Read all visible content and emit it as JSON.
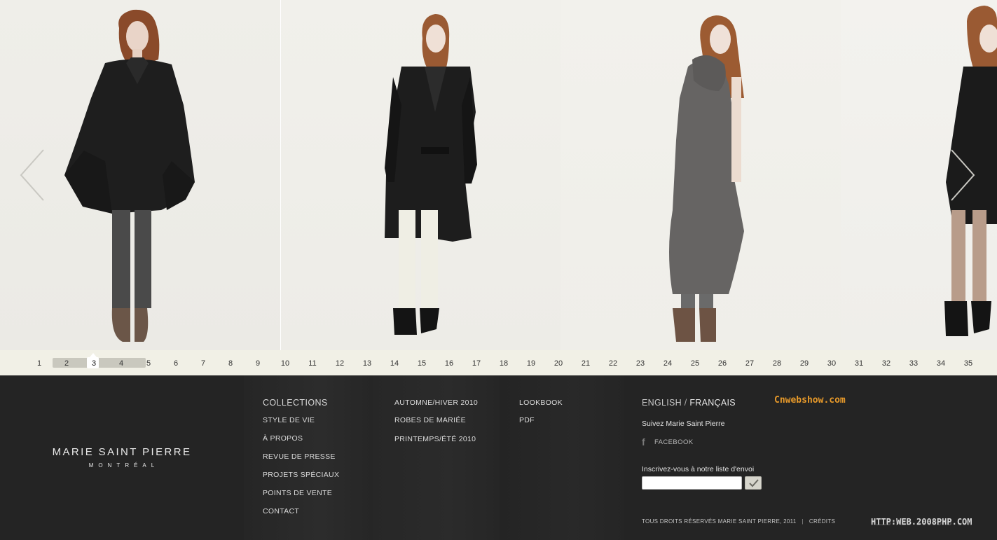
{
  "pager": {
    "current_page": 3,
    "pages": [
      "1",
      "2",
      "3",
      "4",
      "5",
      "6",
      "7",
      "8",
      "9",
      "10",
      "11",
      "12",
      "13",
      "14",
      "15",
      "16",
      "17",
      "18",
      "19",
      "20",
      "21",
      "22",
      "23",
      "24",
      "25",
      "26",
      "27",
      "28",
      "29",
      "30",
      "31",
      "32",
      "33",
      "34",
      "35"
    ]
  },
  "brand": {
    "name": "MARIE SAINT PIERRE",
    "city": "MONTRÉAL"
  },
  "nav": {
    "col1": {
      "heading": "COLLECTIONS",
      "items": [
        "STYLE DE VIE",
        "À PROPOS",
        "REVUE DE PRESSE",
        "PROJETS SPÉCIAUX",
        "POINTS DE VENTE",
        "CONTACT"
      ]
    },
    "col2": {
      "items": [
        "AUTOMNE/HIVER 2010",
        "ROBES DE MARIÉE",
        "PRINTEMPS/ÉTÉ 2010"
      ]
    },
    "col3": {
      "items": [
        "LOOKBOOK",
        "PDF"
      ]
    }
  },
  "lang": {
    "english": "ENGLISH",
    "separator": "/",
    "french": "FRANÇAIS"
  },
  "social": {
    "follow": "Suivez Marie Saint Pierre",
    "facebook": "FACEBOOK",
    "icon": "facebook-icon"
  },
  "newsletter": {
    "label": "Inscrivez-vous à notre liste d'envoi",
    "value": "",
    "placeholder": "",
    "submit_icon": "checkmark-icon"
  },
  "legal": {
    "copyright": "TOUS DROITS RÉSERVÉS MARIE SAINT PIERRE, 2011",
    "separator": "|",
    "credits": "CRÉDITS"
  },
  "watermarks": {
    "top": "Cnwebshow.com",
    "bottom": "HTTP:WEB.2008PHP.COM"
  },
  "icons": {
    "prev": "chevron-left-icon",
    "next": "chevron-right-icon"
  },
  "colors": {
    "gallery_bg": "#efeeea",
    "pager_bg": "#f1f0e6",
    "footer_bg": "#242424",
    "watermark_orange": "#e89a2a"
  }
}
